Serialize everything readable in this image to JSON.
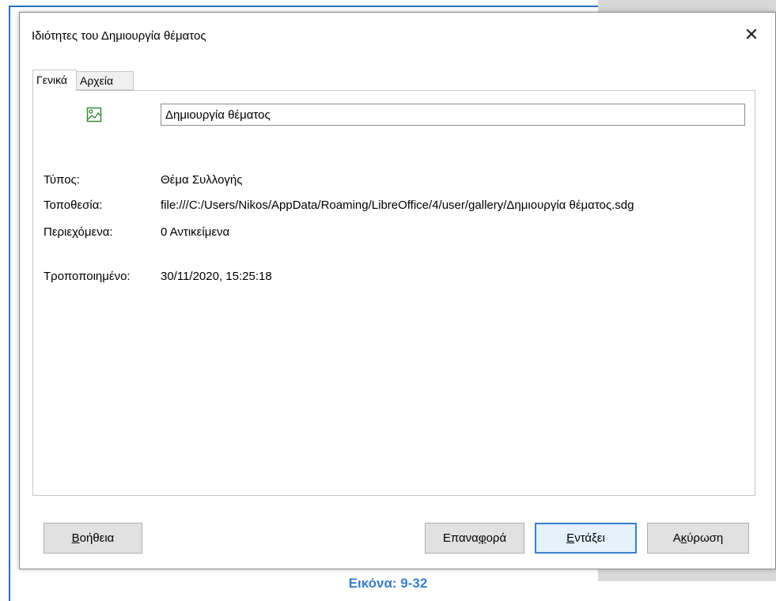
{
  "dialog": {
    "title": "Ιδιότητες του Δημιουργία θέματος",
    "close_glyph": "✕"
  },
  "tabs": [
    {
      "label": "Γενικά",
      "active": true
    },
    {
      "label": "Αρχεία",
      "active": false
    }
  ],
  "general": {
    "icon": "gallery-theme-icon",
    "name_value": "Δημιουργία θέματος",
    "type_label": "Τύπος:",
    "type_value": "Θέμα Συλλογής",
    "location_label": "Τοποθεσία:",
    "location_value": "file:///C:/Users/Nikos/AppData/Roaming/LibreOffice/4/user/gallery/Δημιουργία θέματος.sdg",
    "contents_label": "Περιεχόμενα:",
    "contents_value": "0 Αντικείμενα",
    "modified_label": "Τροποποιημένο:",
    "modified_value": "30/11/2020, 15:25:18"
  },
  "buttons": {
    "help_mnemonic": "Β",
    "help_rest": "οήθεια",
    "reset_pre": "Επανα",
    "reset_mnemonic": "φ",
    "reset_post": "ορά",
    "ok_mnemonic": "Ε",
    "ok_rest": "ντάξει",
    "cancel_pre": "Α",
    "cancel_mnemonic": "κ",
    "cancel_post": "ύρωση"
  },
  "caption": "Εικόνα: 9-32",
  "colors": {
    "accent": "#3a7ec6",
    "ok_border": "#3c7fd1"
  }
}
